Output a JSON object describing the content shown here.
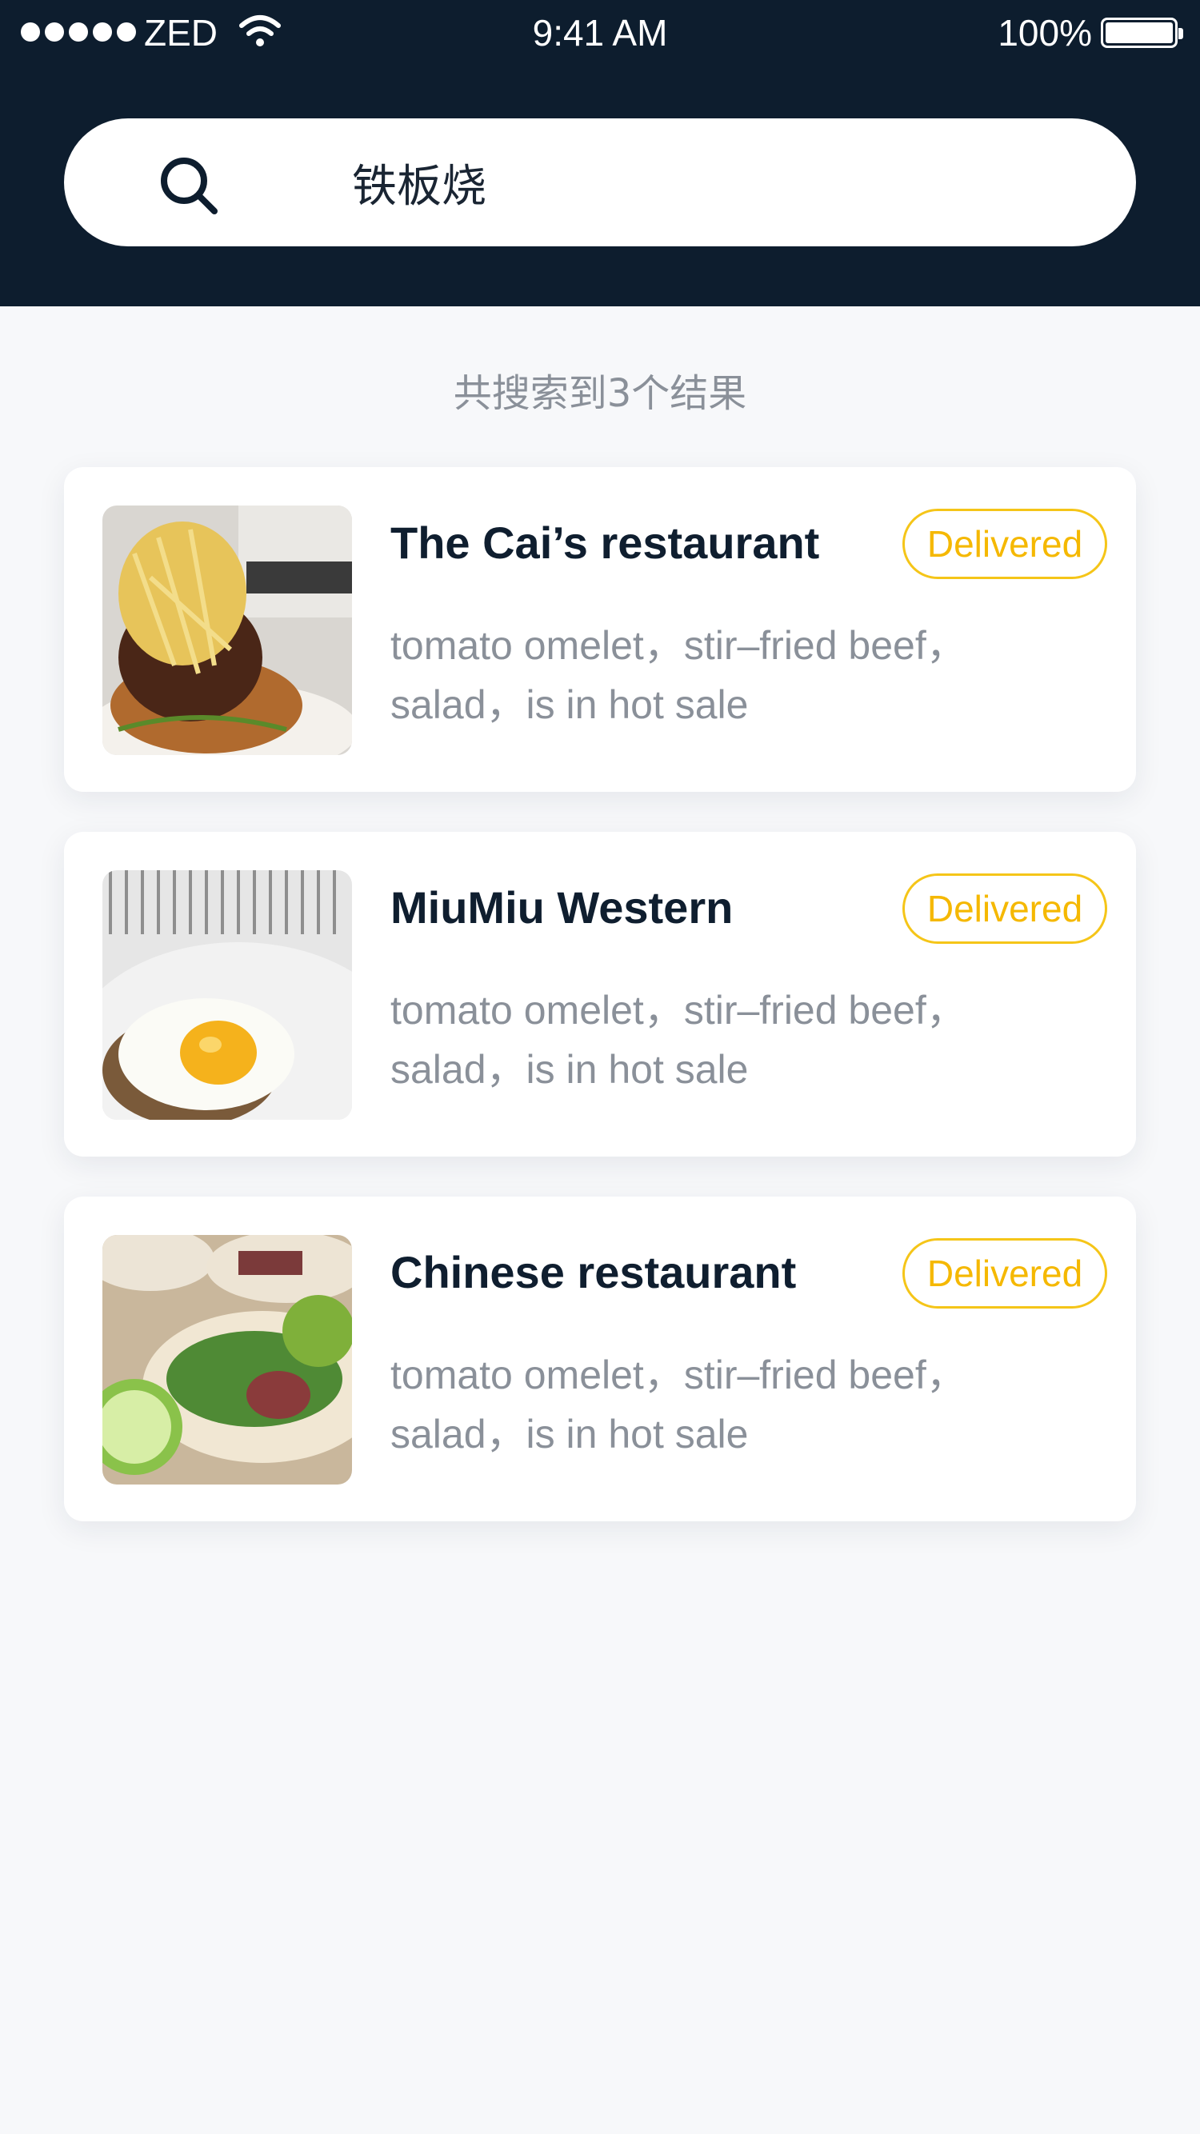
{
  "status_bar": {
    "carrier": "ZED",
    "time": "9:41 AM",
    "battery": "100%",
    "signal_bars": 5
  },
  "search": {
    "value": "铁板烧",
    "icon": "search-icon"
  },
  "results": {
    "count_text": "共搜索到3个结果",
    "items": [
      {
        "name": "The Cai’s restaurant",
        "badge": "Delivered",
        "description": "tomato omelet，stir–fried beef，salad，is in hot sale",
        "image": "skewered-meat-dish-photo"
      },
      {
        "name": "MiuMiu Western",
        "badge": "Delivered",
        "description": "tomato omelet，stir–fried beef，salad，is in hot sale",
        "image": "fried-egg-toast-photo"
      },
      {
        "name": "Chinese restaurant",
        "badge": "Delivered",
        "description": "tomato omelet，stir–fried beef，salad，is in hot sale",
        "image": "tacos-with-lime-photo"
      }
    ]
  },
  "colors": {
    "header_bg": "#0d1d2e",
    "page_bg": "#f7f8fa",
    "badge_accent": "#f5b800",
    "muted_text": "#8a9099",
    "title_text": "#0f1e2f"
  }
}
